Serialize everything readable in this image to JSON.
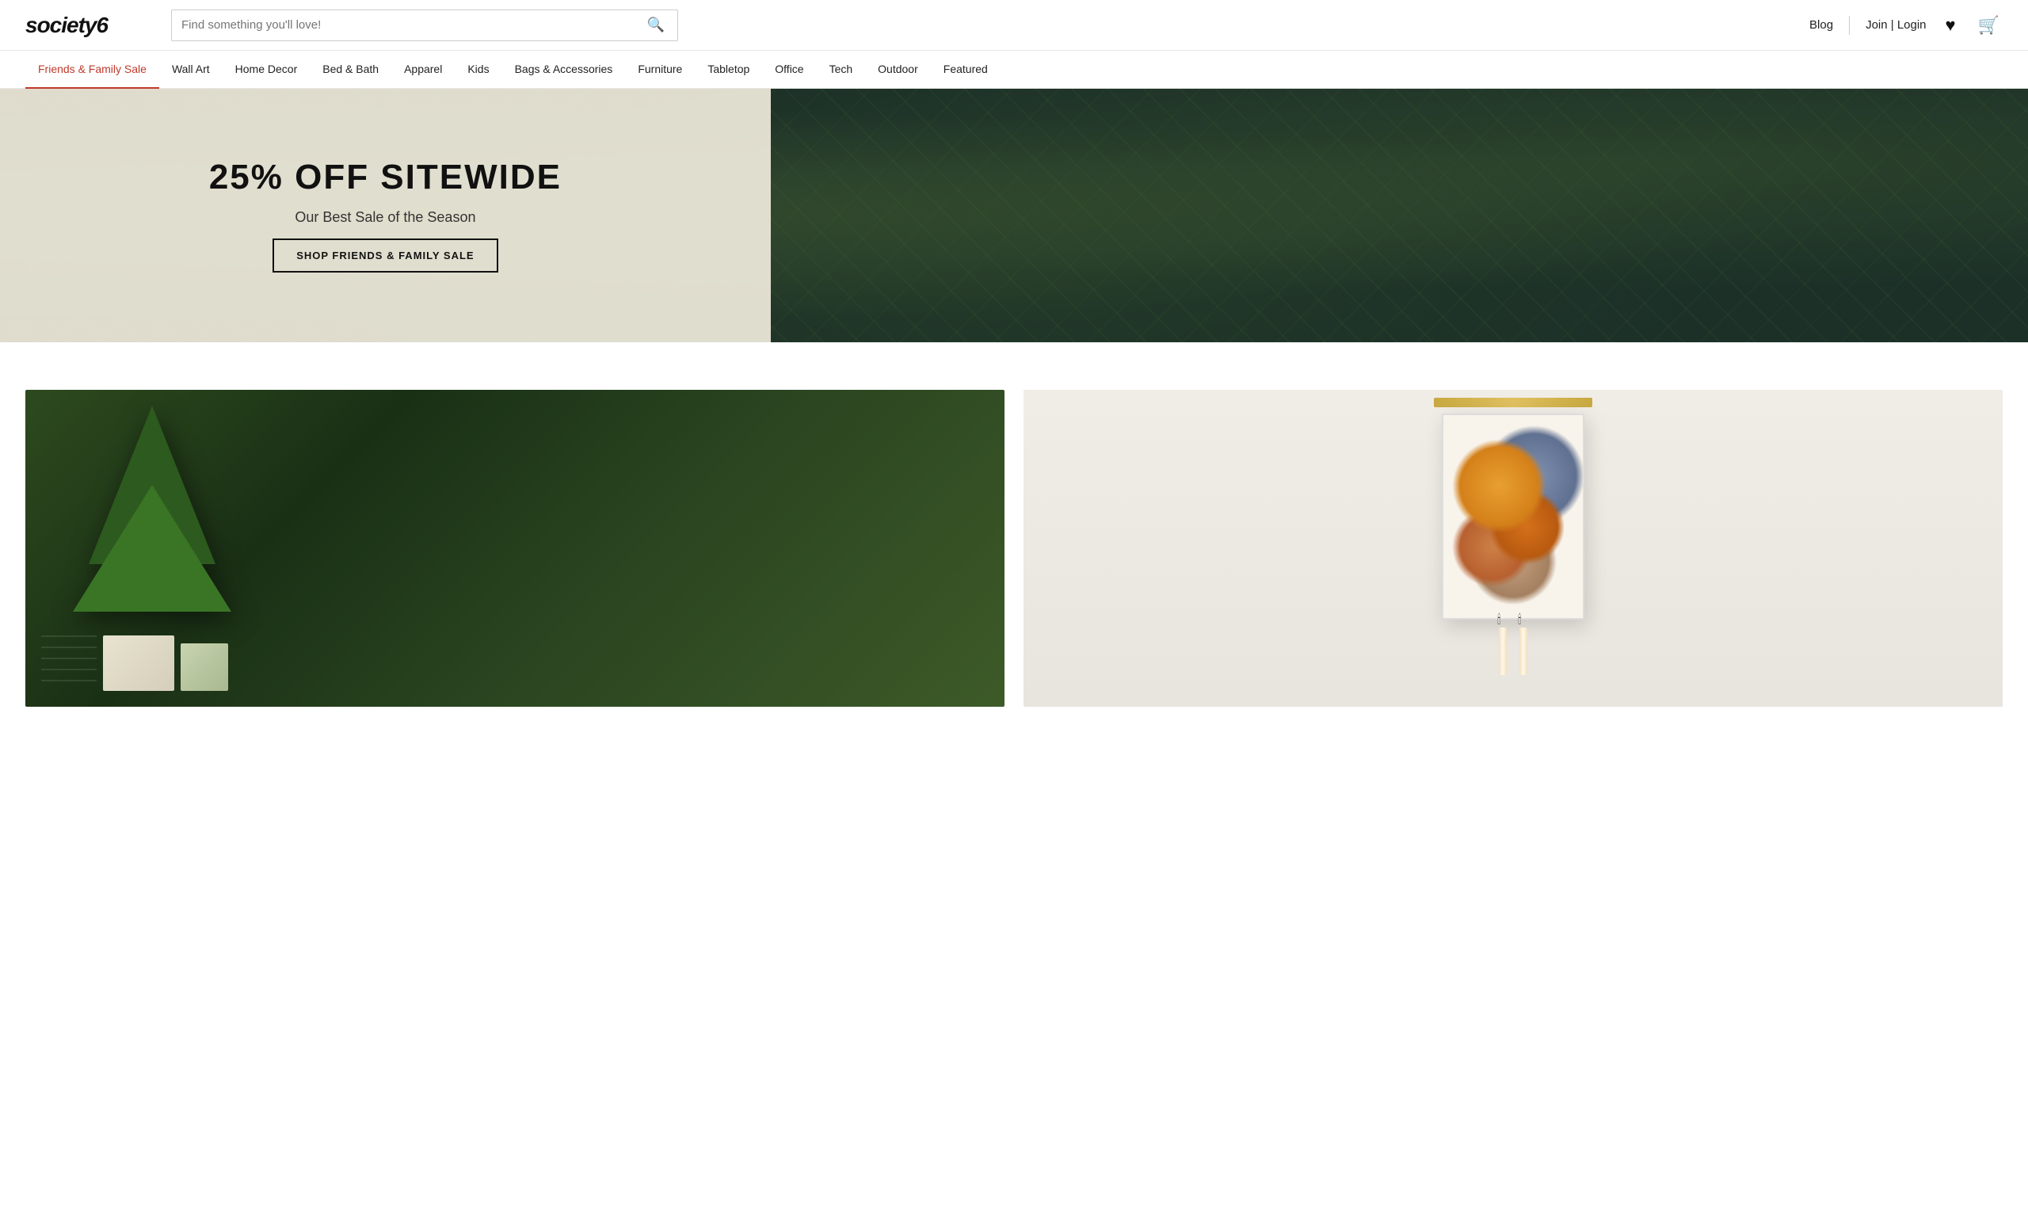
{
  "site": {
    "logo": "society6",
    "search_placeholder": "Find something you'll love!"
  },
  "header": {
    "blog_label": "Blog",
    "auth_label": "Join | Login",
    "wishlist_icon": "♥",
    "cart_icon": "🛒"
  },
  "nav": {
    "items": [
      {
        "id": "friends-family",
        "label": "Friends & Family Sale",
        "active": true
      },
      {
        "id": "wall-art",
        "label": "Wall Art",
        "active": false
      },
      {
        "id": "home-decor",
        "label": "Home Decor",
        "active": false
      },
      {
        "id": "bed-bath",
        "label": "Bed & Bath",
        "active": false
      },
      {
        "id": "apparel",
        "label": "Apparel",
        "active": false
      },
      {
        "id": "kids",
        "label": "Kids",
        "active": false
      },
      {
        "id": "bags-accessories",
        "label": "Bags & Accessories",
        "active": false
      },
      {
        "id": "furniture",
        "label": "Furniture",
        "active": false
      },
      {
        "id": "tabletop",
        "label": "Tabletop",
        "active": false
      },
      {
        "id": "office",
        "label": "Office",
        "active": false
      },
      {
        "id": "tech",
        "label": "Tech",
        "active": false
      },
      {
        "id": "outdoor",
        "label": "Outdoor",
        "active": false
      },
      {
        "id": "featured",
        "label": "Featured",
        "active": false
      }
    ]
  },
  "hero": {
    "title": "25% OFF SITEWIDE",
    "subtitle": "Our Best Sale of the Season",
    "cta_label": "SHOP FRIENDS & FAMILY SALE"
  },
  "products": {
    "card_left_alt": "Holiday gift wrapping under Christmas tree",
    "card_right_alt": "Wall art in living room setting"
  }
}
